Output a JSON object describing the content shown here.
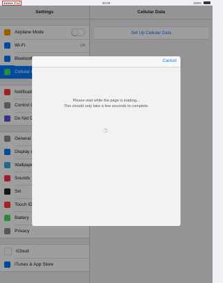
{
  "status_bar": {
    "carrier": "●●●●● iPad",
    "time": "00:00",
    "battery_pct": "100%"
  },
  "left_pane": {
    "title": "Settings",
    "groups": [
      [
        {
          "label": "Airplane Mode",
          "icon": "airplane-icon",
          "color": "#ff9500",
          "control": "toggle-off"
        },
        {
          "label": "Wi-Fi",
          "icon": "wifi-icon",
          "color": "#007aff",
          "value": "Off"
        },
        {
          "label": "Bluetooth",
          "icon": "bluetooth-icon",
          "color": "#007aff"
        },
        {
          "label": "Cellular Data",
          "icon": "cellular-icon",
          "color": "#4cd964",
          "selected": true
        }
      ],
      [
        {
          "label": "Notifications",
          "icon": "notifications-icon",
          "color": "#ff3b30"
        },
        {
          "label": "Control Center",
          "icon": "control-center-icon",
          "color": "#8e8e93"
        },
        {
          "label": "Do Not Disturb",
          "icon": "moon-icon",
          "color": "#5856d6"
        }
      ],
      [
        {
          "label": "General",
          "icon": "gear-icon",
          "color": "#8e8e93"
        },
        {
          "label": "Display & Brightness",
          "icon": "display-icon",
          "color": "#007aff"
        },
        {
          "label": "Wallpaper",
          "icon": "wallpaper-icon",
          "color": "#34aadc"
        },
        {
          "label": "Sounds",
          "icon": "sounds-icon",
          "color": "#ff2d55"
        },
        {
          "label": "Siri",
          "icon": "siri-icon",
          "color": "#222222"
        },
        {
          "label": "Touch ID & Passcode",
          "icon": "fingerprint-icon",
          "color": "#ff3b30"
        },
        {
          "label": "Battery",
          "icon": "battery-icon",
          "color": "#4cd964"
        },
        {
          "label": "Privacy",
          "icon": "privacy-icon",
          "color": "#8e8e93"
        }
      ],
      [
        {
          "label": "iCloud",
          "icon": "icloud-icon",
          "color": "#ffffff"
        },
        {
          "label": "iTunes & App Store",
          "icon": "app-store-icon",
          "color": "#007aff"
        }
      ]
    ]
  },
  "right_pane": {
    "title": "Cellular Data",
    "setup_button": "Set Up Cellular Data"
  },
  "modal": {
    "cancel": "Cancel",
    "message_line1": "Please wait while the page is loading...",
    "message_line2": "This should only take a few seconds to complete."
  }
}
